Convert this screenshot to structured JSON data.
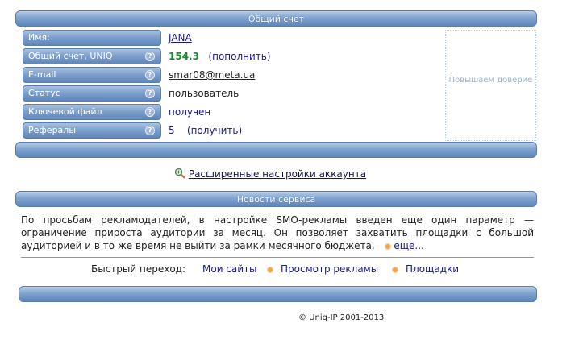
{
  "account": {
    "title": "Общий счет",
    "rows": [
      {
        "label": "Имя:",
        "value": "JANA"
      },
      {
        "label": "Общий счет, UNIQ",
        "value": "154.3",
        "action": "(пополнить)"
      },
      {
        "label": "E-mail",
        "value": "smar08@meta.ua"
      },
      {
        "label": "Статус",
        "value": "пользователь"
      },
      {
        "label": "Ключевой файл",
        "value": "получен"
      },
      {
        "label": "Рефералы",
        "value": "5",
        "action": "(получить)"
      }
    ],
    "help_glyph": "?",
    "trust_text": "Повышаем доверие"
  },
  "advanced_settings": {
    "icon": "magnifier-settings-icon",
    "label": "Расширенные настройки аккаунта"
  },
  "news": {
    "title": "Новости сервиса",
    "text": "По просьбам рекламодателей, в настройке SMO-рекламы введен еще один параметр — ограничение прироста аудитории за месяц. Он позволяет захватить площадки с большой аудиторией и в то же время не выйти за рамки месячного бюджета.",
    "more": "еще..."
  },
  "quick_nav": {
    "label": "Быстрый переход:",
    "links": [
      "Мои сайты",
      "Просмотр рекламы",
      "Площадки"
    ]
  },
  "footer": {
    "copyright": "© Uniq-IP 2001-2013"
  },
  "colors": {
    "bar": "#7fa3cf",
    "link": "#1a1a8c",
    "balance": "#148a2c",
    "bullet": "#f0a64a"
  }
}
